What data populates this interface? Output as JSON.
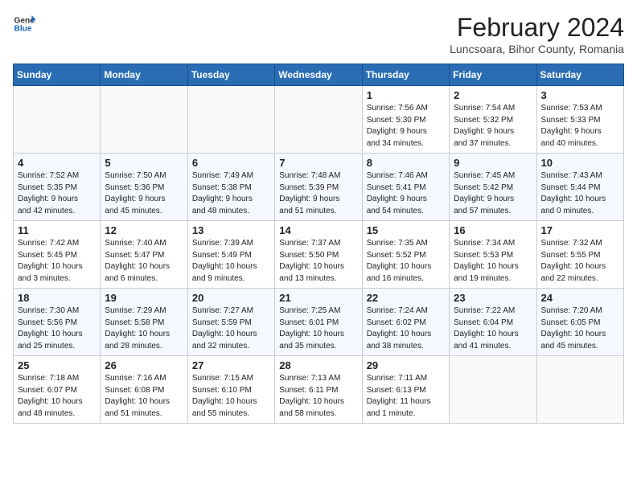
{
  "header": {
    "logo_general": "General",
    "logo_blue": "Blue",
    "month_title": "February 2024",
    "location": "Luncsoara, Bihor County, Romania"
  },
  "weekdays": [
    "Sunday",
    "Monday",
    "Tuesday",
    "Wednesday",
    "Thursday",
    "Friday",
    "Saturday"
  ],
  "weeks": [
    [
      {
        "day": "",
        "info": ""
      },
      {
        "day": "",
        "info": ""
      },
      {
        "day": "",
        "info": ""
      },
      {
        "day": "",
        "info": ""
      },
      {
        "day": "1",
        "info": "Sunrise: 7:56 AM\nSunset: 5:30 PM\nDaylight: 9 hours\nand 34 minutes."
      },
      {
        "day": "2",
        "info": "Sunrise: 7:54 AM\nSunset: 5:32 PM\nDaylight: 9 hours\nand 37 minutes."
      },
      {
        "day": "3",
        "info": "Sunrise: 7:53 AM\nSunset: 5:33 PM\nDaylight: 9 hours\nand 40 minutes."
      }
    ],
    [
      {
        "day": "4",
        "info": "Sunrise: 7:52 AM\nSunset: 5:35 PM\nDaylight: 9 hours\nand 42 minutes."
      },
      {
        "day": "5",
        "info": "Sunrise: 7:50 AM\nSunset: 5:36 PM\nDaylight: 9 hours\nand 45 minutes."
      },
      {
        "day": "6",
        "info": "Sunrise: 7:49 AM\nSunset: 5:38 PM\nDaylight: 9 hours\nand 48 minutes."
      },
      {
        "day": "7",
        "info": "Sunrise: 7:48 AM\nSunset: 5:39 PM\nDaylight: 9 hours\nand 51 minutes."
      },
      {
        "day": "8",
        "info": "Sunrise: 7:46 AM\nSunset: 5:41 PM\nDaylight: 9 hours\nand 54 minutes."
      },
      {
        "day": "9",
        "info": "Sunrise: 7:45 AM\nSunset: 5:42 PM\nDaylight: 9 hours\nand 57 minutes."
      },
      {
        "day": "10",
        "info": "Sunrise: 7:43 AM\nSunset: 5:44 PM\nDaylight: 10 hours\nand 0 minutes."
      }
    ],
    [
      {
        "day": "11",
        "info": "Sunrise: 7:42 AM\nSunset: 5:45 PM\nDaylight: 10 hours\nand 3 minutes."
      },
      {
        "day": "12",
        "info": "Sunrise: 7:40 AM\nSunset: 5:47 PM\nDaylight: 10 hours\nand 6 minutes."
      },
      {
        "day": "13",
        "info": "Sunrise: 7:39 AM\nSunset: 5:49 PM\nDaylight: 10 hours\nand 9 minutes."
      },
      {
        "day": "14",
        "info": "Sunrise: 7:37 AM\nSunset: 5:50 PM\nDaylight: 10 hours\nand 13 minutes."
      },
      {
        "day": "15",
        "info": "Sunrise: 7:35 AM\nSunset: 5:52 PM\nDaylight: 10 hours\nand 16 minutes."
      },
      {
        "day": "16",
        "info": "Sunrise: 7:34 AM\nSunset: 5:53 PM\nDaylight: 10 hours\nand 19 minutes."
      },
      {
        "day": "17",
        "info": "Sunrise: 7:32 AM\nSunset: 5:55 PM\nDaylight: 10 hours\nand 22 minutes."
      }
    ],
    [
      {
        "day": "18",
        "info": "Sunrise: 7:30 AM\nSunset: 5:56 PM\nDaylight: 10 hours\nand 25 minutes."
      },
      {
        "day": "19",
        "info": "Sunrise: 7:29 AM\nSunset: 5:58 PM\nDaylight: 10 hours\nand 28 minutes."
      },
      {
        "day": "20",
        "info": "Sunrise: 7:27 AM\nSunset: 5:59 PM\nDaylight: 10 hours\nand 32 minutes."
      },
      {
        "day": "21",
        "info": "Sunrise: 7:25 AM\nSunset: 6:01 PM\nDaylight: 10 hours\nand 35 minutes."
      },
      {
        "day": "22",
        "info": "Sunrise: 7:24 AM\nSunset: 6:02 PM\nDaylight: 10 hours\nand 38 minutes."
      },
      {
        "day": "23",
        "info": "Sunrise: 7:22 AM\nSunset: 6:04 PM\nDaylight: 10 hours\nand 41 minutes."
      },
      {
        "day": "24",
        "info": "Sunrise: 7:20 AM\nSunset: 6:05 PM\nDaylight: 10 hours\nand 45 minutes."
      }
    ],
    [
      {
        "day": "25",
        "info": "Sunrise: 7:18 AM\nSunset: 6:07 PM\nDaylight: 10 hours\nand 48 minutes."
      },
      {
        "day": "26",
        "info": "Sunrise: 7:16 AM\nSunset: 6:08 PM\nDaylight: 10 hours\nand 51 minutes."
      },
      {
        "day": "27",
        "info": "Sunrise: 7:15 AM\nSunset: 6:10 PM\nDaylight: 10 hours\nand 55 minutes."
      },
      {
        "day": "28",
        "info": "Sunrise: 7:13 AM\nSunset: 6:11 PM\nDaylight: 10 hours\nand 58 minutes."
      },
      {
        "day": "29",
        "info": "Sunrise: 7:11 AM\nSunset: 6:13 PM\nDaylight: 11 hours\nand 1 minute."
      },
      {
        "day": "",
        "info": ""
      },
      {
        "day": "",
        "info": ""
      }
    ]
  ]
}
